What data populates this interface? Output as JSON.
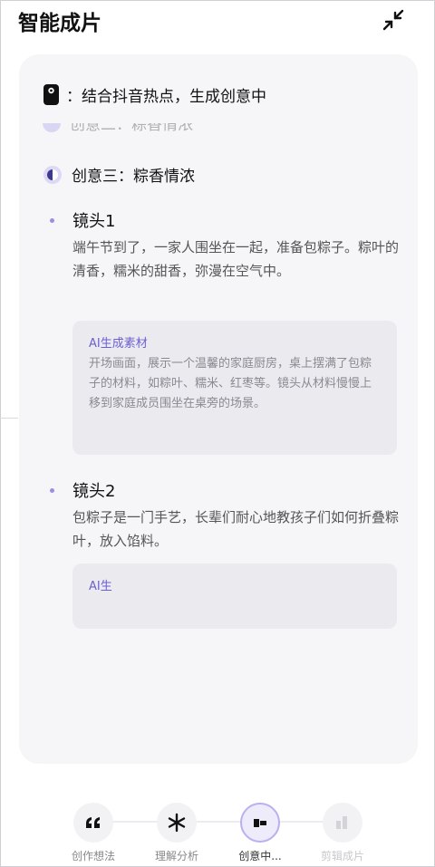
{
  "header": {
    "title": "智能成片"
  },
  "status": {
    "text": "：结合抖音热点，生成创意中"
  },
  "previous_idea": {
    "text": "创意二：粽香情浓"
  },
  "idea": {
    "text": "创意三：粽香情浓"
  },
  "shots": [
    {
      "title": "镜头1",
      "desc": "端午节到了，一家人围坐在一起，准备包粽子。粽叶的清香，糯米的甜香，弥漫在空气中。",
      "ai_label": "AI生成素材",
      "ai_body": "开场画面，展示一个温馨的家庭厨房，桌上摆满了包粽子的材料，如粽叶、糯米、红枣等。镜头从材料慢慢上移到家庭成员围坐在桌旁的场景。"
    },
    {
      "title": "镜头2",
      "desc": "包粽子是一门手艺，长辈们耐心地教孩子们如何折叠粽叶，放入馅料。",
      "ai_label": "AI生",
      "ai_body": ""
    }
  ],
  "steps": [
    {
      "label": "创作想法",
      "icon": "quote-icon",
      "state": "done"
    },
    {
      "label": "理解分析",
      "icon": "asterisk-icon",
      "state": "done"
    },
    {
      "label": "创意中...",
      "icon": "generating-icon",
      "state": "active"
    },
    {
      "label": "剪辑成片",
      "icon": "edit-film-icon",
      "state": "disabled"
    }
  ],
  "colors": {
    "accent": "#6b5fd3",
    "card_bg": "#f6f6f8",
    "ai_box_bg": "#eaeaef"
  }
}
